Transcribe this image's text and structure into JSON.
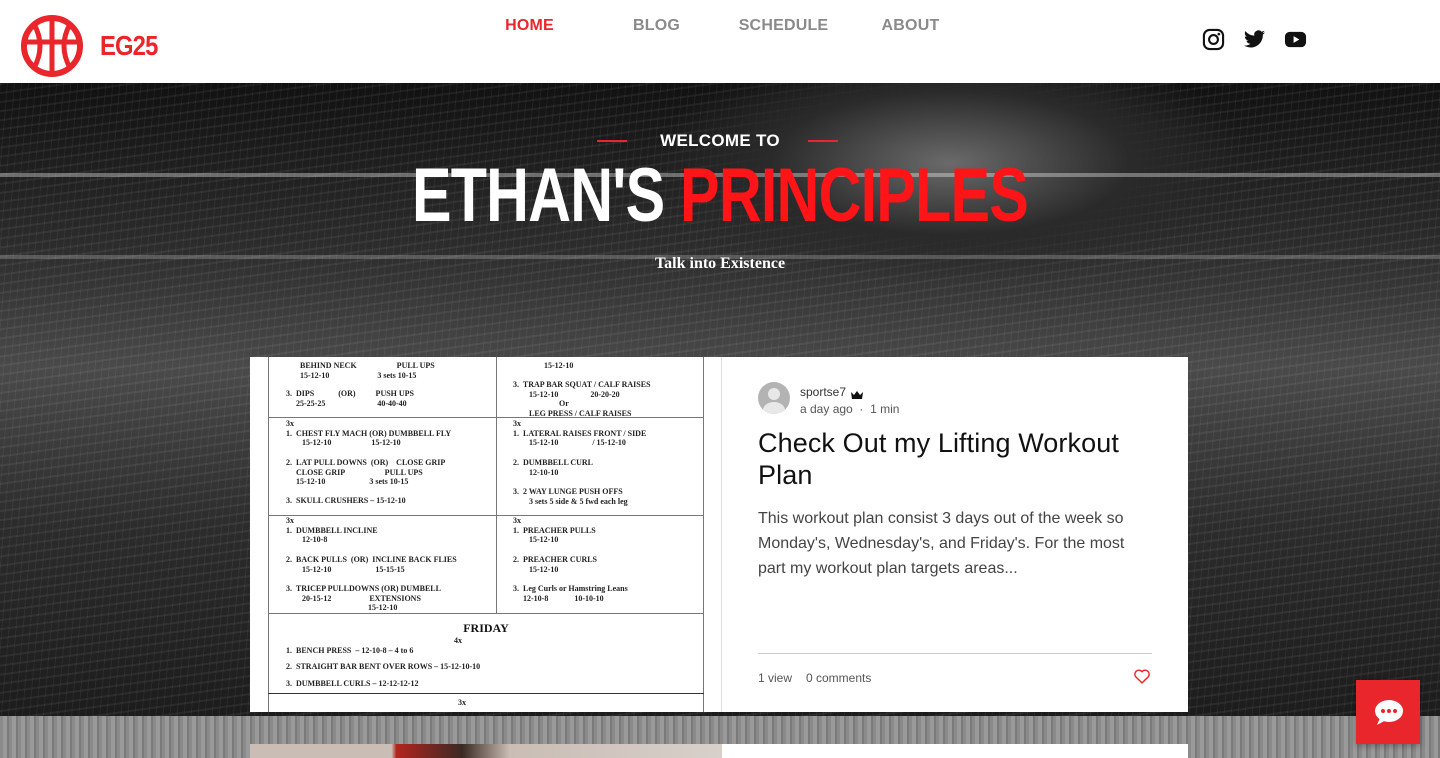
{
  "brand": {
    "name": "EG25",
    "accent_color": "#e8262c",
    "logo_icon": "basketball-icon"
  },
  "nav": {
    "items": [
      {
        "label": "HOME",
        "active": true
      },
      {
        "label": "BLOG",
        "active": false
      },
      {
        "label": "SCHEDULE",
        "active": false
      },
      {
        "label": "ABOUT",
        "active": false
      }
    ]
  },
  "social": [
    "instagram-icon",
    "twitter-icon",
    "youtube-icon"
  ],
  "hero": {
    "welcome": "WELCOME TO",
    "title_white": "ETHAN'S",
    "title_red": "PRINCIPLES",
    "tagline": "Talk into Existence"
  },
  "post": {
    "image_sheet": {
      "left_col": [
        "BEHIND NECK                    PULL UPS\n15-12-10                        3 sets 10-15",
        "3.  DIPS            (OR)          PUSH UPS\n     25-25-25                          40-40-40",
        "3x\n1.  CHEST FLY MACH (OR) DUMBBELL FLY\n        15-12-10                    15-12-10",
        "2.  LAT PULL DOWNS  (OR)    CLOSE GRIP\n     CLOSE GRIP                    PULL UPS\n     15-12-10                      3 sets 10-15",
        "3.  SKULL CRUSHERS – 15-12-10",
        "3x\n1.  DUMBBELL INCLINE\n        12-10-8",
        "2.  BACK PULLS  (OR)  INCLINE BACK FLIES\n        15-12-10                      15-15-15",
        "3.  TRICEP PULLDOWNS (OR) DUMBELL\n        20-15-12                   EXTENSIONS\n                                         15-12-10"
      ],
      "right_col": [
        "15-12-10",
        "3.  TRAP BAR SQUAT / CALF RAISES\n        15-12-10                20-20-20\n                       Or\n        LEG PRESS / CALF RAISES",
        "3x\n1.  LATERAL RAISES FRONT / SIDE\n        15-12-10                 / 15-12-10",
        "2.  DUMBBELL CURL\n        12-10-10",
        "3.  2 WAY LUNGE PUSH OFFS\n        3 sets 5 side & 5 fwd each leg",
        "3x\n1.  PREACHER PULLS\n        15-12-10",
        "2.  PREACHER CURLS\n        15-12-10",
        "3.  Leg Curls or Hamstring Leans\n     12-10-8             10-10-10"
      ],
      "friday_heading": "FRIDAY",
      "friday_items": [
        "4x",
        "1.  BENCH PRESS  – 12-10-8 – 4 to 6",
        "2.  STRAIGHT BAR BENT OVER ROWS – 15-12-10-10",
        "3.  DUMBBELL CURLS – 12-12-12-12",
        "3x"
      ]
    },
    "author": "sportse7",
    "author_badge_icon": "crown-icon",
    "time_ago": "a day ago",
    "separator": "·",
    "read_time": "1 min",
    "title": "Check Out my Lifting Workout Plan",
    "excerpt": "This workout plan consist 3 days out of the week so Monday's, Wednesday's, and Friday's. For the most part my workout plan targets areas...",
    "views": "1 view",
    "comments": "0 comments",
    "like_icon": "heart-icon",
    "like_color": "#e8262c"
  },
  "chat": {
    "icon": "chat-bubble-icon"
  }
}
